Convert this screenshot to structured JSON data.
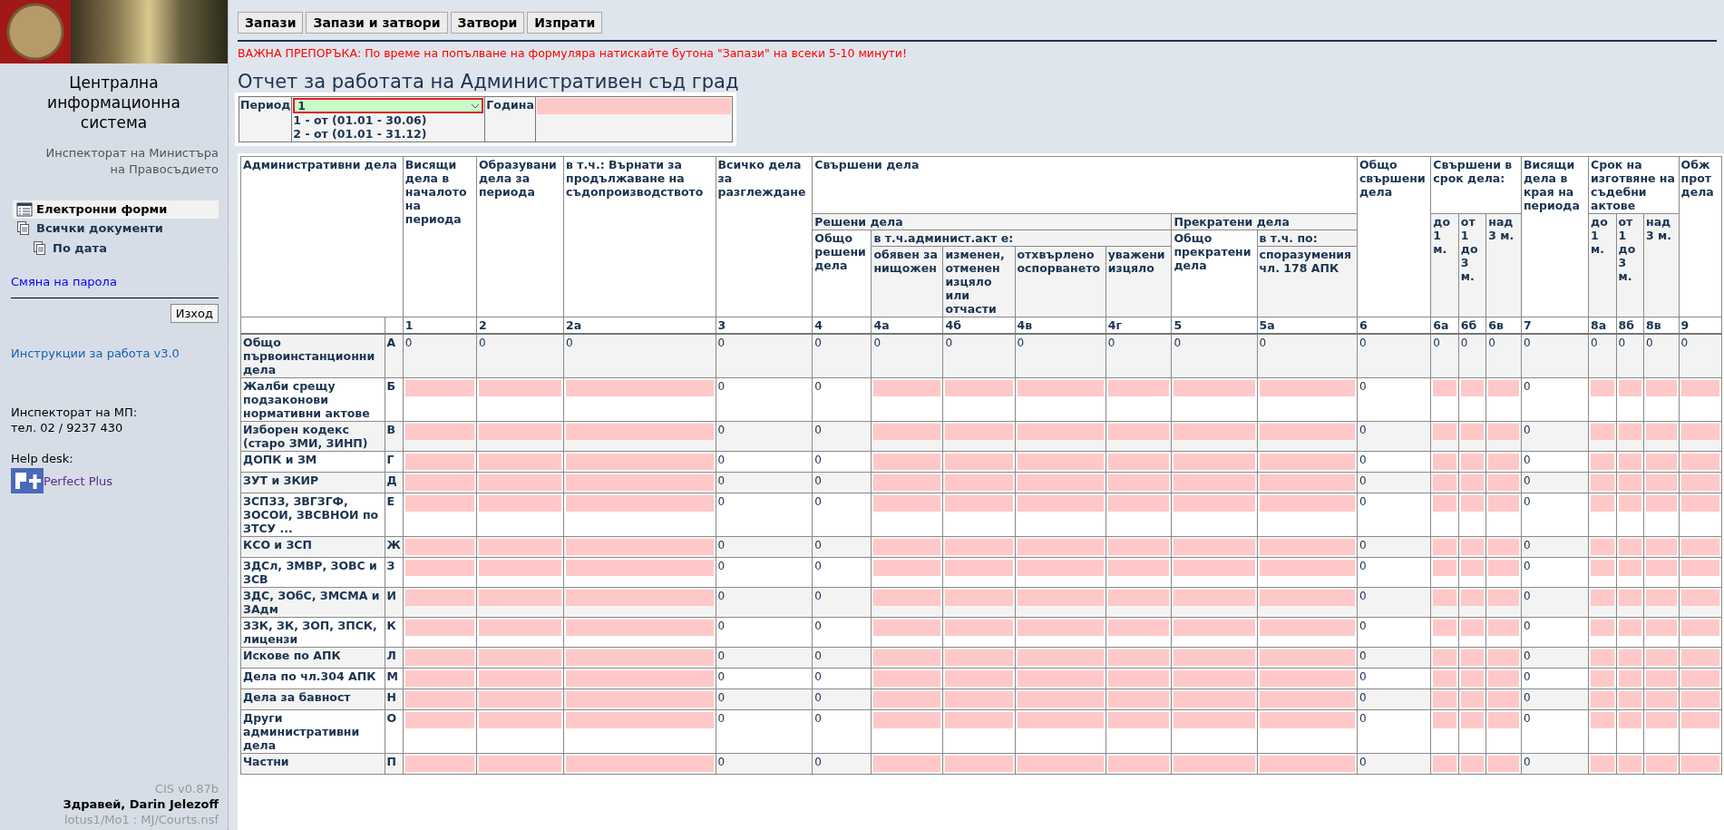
{
  "sidebar": {
    "system_title": "Централна информационна система",
    "organization": "Инспекторат на Министъра на Правосъдието",
    "nav": [
      {
        "label": "Електронни форми",
        "kind": "form",
        "selected": true
      },
      {
        "label": "Всички документи",
        "kind": "documents",
        "selected": false,
        "children": [
          {
            "label": "По дата",
            "kind": "documents",
            "selected": false
          }
        ]
      }
    ],
    "change_password_link": "Смяна на парола",
    "logout_button": "Изход",
    "instructions_link": "Инструкции за работа v3.0",
    "contact_lines": [
      "Инспекторат на МП:",
      "тел. 02 / 9237 430"
    ],
    "helpdesk_label": "Help desk:",
    "helpdesk_link": "Perfect Plus",
    "version": "CIS v0.87b",
    "greeting": "Здравей, Darin Jelezoff",
    "database_path": "lotus1/Mo1 : MJ/Courts.nsf"
  },
  "toolbar": {
    "buttons": [
      "Запази",
      "Запази и затвори",
      "Затвори",
      "Изпрати"
    ]
  },
  "warning": "ВАЖНА ПРЕПОРЪКА: По време на попълване на формуляра натискайте бутона \"Запази\" на всеки 5-10 минути!",
  "title": "Отчет за работата на Административен съд град",
  "period_form": {
    "period_label": "Период",
    "period_value": "1",
    "period_options": [
      "1 - от (01.01 - 30.06)",
      "2 - от (01.01 - 31.12)"
    ],
    "year_label": "Година"
  },
  "table": {
    "corner": "Административни дела",
    "headers": [
      {
        "label": "Висящи дела в началото на периода",
        "number": "1",
        "kind": "input"
      },
      {
        "label": "Образувани дела за периода",
        "number": "2",
        "kind": "input"
      },
      {
        "label": "в т.ч.: Върнати за продължаване на съдопроизводството",
        "number": "2а",
        "kind": "input"
      },
      {
        "label": "Всичко дела за разглеждане",
        "number": "3",
        "kind": "computed"
      },
      {
        "label": "Свършени дела",
        "children": [
          {
            "label": "Решени дела",
            "children": [
              {
                "label": "Общо решени дела",
                "number": "4",
                "kind": "computed"
              },
              {
                "label": "в т.ч.админист.акт е:",
                "children": [
                  {
                    "label": "обявен за нищожен",
                    "number": "4а",
                    "kind": "input"
                  },
                  {
                    "label": "изменен, отменен изцяло или отчасти",
                    "number": "4б",
                    "kind": "input"
                  },
                  {
                    "label": "отхвърлено оспорването",
                    "number": "4в",
                    "kind": "input"
                  },
                  {
                    "label": "уважени изцяло",
                    "number": "4г",
                    "kind": "input"
                  }
                ]
              }
            ]
          },
          {
            "label": "Прекратени дела",
            "children": [
              {
                "label": "Общо прекратени дела",
                "number": "5",
                "kind": "input"
              },
              {
                "label": "в т.ч. по:",
                "children": [
                  {
                    "label": "споразумения чл. 178 АПК",
                    "number": "5а",
                    "kind": "input"
                  }
                ]
              }
            ]
          }
        ]
      },
      {
        "label": "Общо свършени дела",
        "number": "6",
        "kind": "computed"
      },
      {
        "label": "Свършени в срок дела:",
        "children": [
          {
            "label": "до 1 м.",
            "number": "6а",
            "kind": "input"
          },
          {
            "label": "от 1 до 3 м.",
            "number": "6б",
            "kind": "input"
          },
          {
            "label": "над 3 м.",
            "number": "6в",
            "kind": "input"
          }
        ]
      },
      {
        "label": "Висящи дела в края на периода",
        "number": "7",
        "kind": "computed"
      },
      {
        "label": "Срок на изготвяне на съдебни актове",
        "children": [
          {
            "label": "до 1 м.",
            "number": "8а",
            "kind": "input"
          },
          {
            "label": "от 1 до 3 м.",
            "number": "8б",
            "kind": "input"
          },
          {
            "label": "над 3 м.",
            "number": "8в",
            "kind": "input"
          }
        ]
      },
      {
        "label": "Обж прот дела",
        "number": "9",
        "kind": "input"
      }
    ],
    "rows": [
      {
        "label": "Общо първоинстанционни дела",
        "letter": "А",
        "kind": "total",
        "values": [
          "0",
          "0",
          "0",
          "0",
          "0",
          "0",
          "0",
          "0",
          "0",
          "0",
          "0",
          "0",
          "0",
          "0",
          "0",
          "0",
          "0",
          "0",
          "0",
          "0"
        ]
      },
      {
        "label": "Жалби срещу подзаконови нормативни актове",
        "letter": "Б",
        "kind": "entry",
        "values": [
          "0",
          "0",
          "0",
          "0"
        ]
      },
      {
        "label": "Изборен кодекс (старо ЗМИ, ЗИНП)",
        "letter": "В",
        "kind": "entry",
        "values": [
          "0",
          "0",
          "0",
          "0"
        ]
      },
      {
        "label": "ДОПК и ЗМ",
        "letter": "Г",
        "kind": "entry",
        "values": [
          "0",
          "0",
          "0",
          "0"
        ]
      },
      {
        "label": "ЗУТ и ЗКИР",
        "letter": "Д",
        "kind": "entry",
        "values": [
          "0",
          "0",
          "0",
          "0"
        ]
      },
      {
        "label": "ЗСПЗЗ, ЗВГЗГФ, ЗОСОИ, ЗВСВНОИ по ЗТСУ ...",
        "letter": "Е",
        "kind": "entry",
        "values": [
          "0",
          "0",
          "0",
          "0"
        ]
      },
      {
        "label": "КСО и ЗСП",
        "letter": "Ж",
        "kind": "entry",
        "values": [
          "0",
          "0",
          "0",
          "0"
        ]
      },
      {
        "label": "ЗДСл, ЗМВР, ЗОВС и ЗСВ",
        "letter": "З",
        "kind": "entry",
        "values": [
          "0",
          "0",
          "0",
          "0"
        ]
      },
      {
        "label": "ЗДС, ЗОбС, ЗМСМА и ЗАдм",
        "letter": "И",
        "kind": "entry",
        "values": [
          "0",
          "0",
          "0",
          "0"
        ]
      },
      {
        "label": "ЗЗК, ЗК, ЗОП, ЗПСК, лицензи",
        "letter": "К",
        "kind": "entry",
        "values": [
          "0",
          "0",
          "0",
          "0"
        ]
      },
      {
        "label": "Искове по АПК",
        "letter": "Л",
        "kind": "entry",
        "values": [
          "0",
          "0",
          "0",
          "0"
        ]
      },
      {
        "label": "Дела по чл.304 АПК",
        "letter": "М",
        "kind": "entry",
        "values": [
          "0",
          "0",
          "0",
          "0"
        ]
      },
      {
        "label": "Дела за бавност",
        "letter": "Н",
        "kind": "entry",
        "values": [
          "0",
          "0",
          "0",
          "0"
        ]
      },
      {
        "label": "Други административни дела",
        "letter": "О",
        "kind": "entry",
        "values": [
          "0",
          "0",
          "0",
          "0"
        ]
      },
      {
        "label": "Частни",
        "letter": "П",
        "kind": "entry",
        "values": [
          "0",
          "0",
          "0",
          "0"
        ]
      }
    ]
  }
}
